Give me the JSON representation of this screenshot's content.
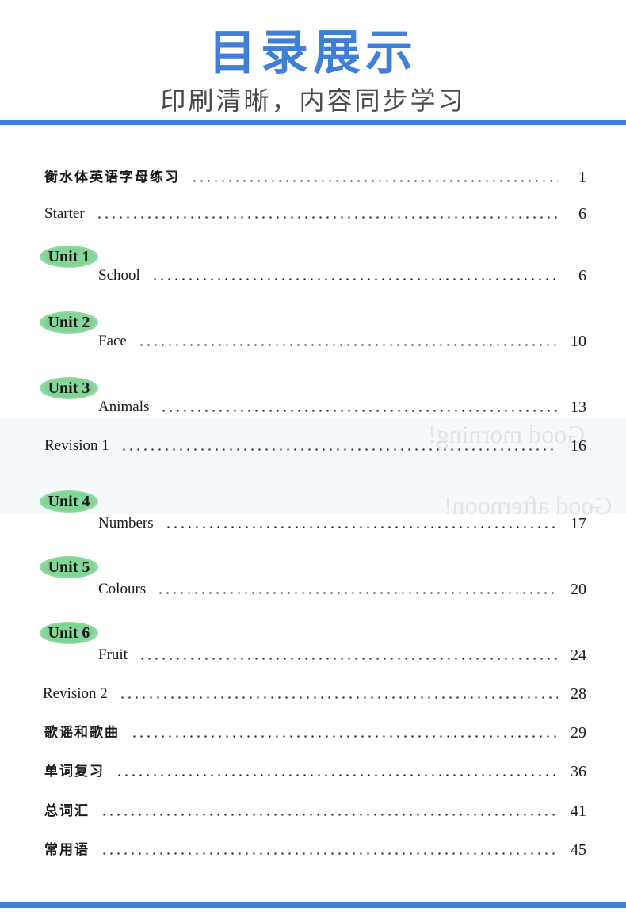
{
  "header": {
    "title": "目录展示",
    "subtitle": "印刷清晰，内容同步学习"
  },
  "colors": {
    "accent": "#3f7fd6",
    "unit_badge": "#7ed394"
  },
  "toc": {
    "intro": [
      {
        "label": "衡水体英语字母练习",
        "page": "1"
      },
      {
        "label": "Starter",
        "page": "6"
      }
    ],
    "units": [
      {
        "badge": "Unit 1",
        "label": "School",
        "page": "6"
      },
      {
        "badge": "Unit 2",
        "label": "Face",
        "page": "10"
      },
      {
        "badge": "Unit 3",
        "label": "Animals",
        "page": "13"
      },
      {
        "badge": "Unit 4",
        "label": "Numbers",
        "page": "17"
      },
      {
        "badge": "Unit 5",
        "label": "Colours",
        "page": "20"
      },
      {
        "badge": "Unit 6",
        "label": "Fruit",
        "page": "24"
      }
    ],
    "revision1": {
      "label": "Revision 1",
      "page": "16"
    },
    "revision2": {
      "label": "Revision 2",
      "page": "28"
    },
    "appendix": [
      {
        "label": "歌谣和歌曲",
        "page": "29"
      },
      {
        "label": "单词复习",
        "page": "36"
      },
      {
        "label": "总词汇",
        "page": "41"
      },
      {
        "label": "常用语",
        "page": "45"
      }
    ]
  },
  "bleed_through": {
    "line1": "Good morning!",
    "line2": "Good afternoon!"
  }
}
